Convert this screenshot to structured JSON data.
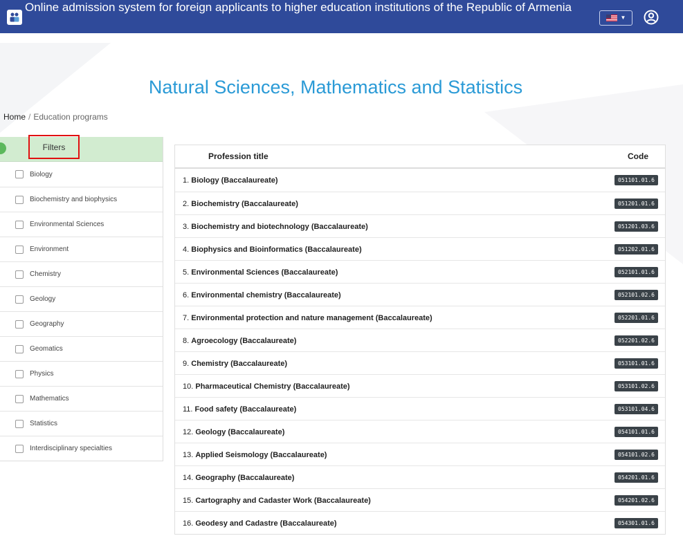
{
  "header": {
    "title": "Online admission system for foreign applicants to higher education institutions of the Republic of Armenia",
    "language_icon": "us-flag-icon",
    "user_icon": "user-circle-icon"
  },
  "page": {
    "title": "Natural Sciences, Mathematics and Statistics"
  },
  "breadcrumb": {
    "home": "Home",
    "separator": "/",
    "current": "Education programs"
  },
  "filters": {
    "title": "Filters",
    "items": [
      "Biology",
      "Biochemistry and biophysics",
      "Environmental Sciences",
      "Environment",
      "Chemistry",
      "Geology",
      "Geography",
      "Geomatics",
      "Physics",
      "Mathematics",
      "Statistics",
      "Interdisciplinary specialties"
    ]
  },
  "table": {
    "col_title": "Profession title",
    "col_code": "Code",
    "rows": [
      {
        "num": "1.",
        "title": "Biology (Baccalaureate)",
        "code": "051101.01.6"
      },
      {
        "num": "2.",
        "title": "Biochemistry (Baccalaureate)",
        "code": "051201.01.6"
      },
      {
        "num": "3.",
        "title": "Biochemistry and biotechnology (Baccalaureate)",
        "code": "051201.03.6"
      },
      {
        "num": "4.",
        "title": "Biophysics and Bioinformatics (Baccalaureate)",
        "code": "051202.01.6"
      },
      {
        "num": "5.",
        "title": "Environmental Sciences (Baccalaureate)",
        "code": "052101.01.6"
      },
      {
        "num": "6.",
        "title": "Environmental chemistry (Baccalaureate)",
        "code": "052101.02.6"
      },
      {
        "num": "7.",
        "title": "Environmental protection and nature management (Baccalaureate)",
        "code": "052201.01.6"
      },
      {
        "num": "8.",
        "title": "Agroecology (Baccalaureate)",
        "code": "052201.02.6"
      },
      {
        "num": "9.",
        "title": "Chemistry (Baccalaureate)",
        "code": "053101.01.6"
      },
      {
        "num": "10.",
        "title": "Pharmaceutical Chemistry (Baccalaureate)",
        "code": "053101.02.6"
      },
      {
        "num": "11.",
        "title": "Food safety (Baccalaureate)",
        "code": "053101.04.6"
      },
      {
        "num": "12.",
        "title": "Geology (Baccalaureate)",
        "code": "054101.01.6"
      },
      {
        "num": "13.",
        "title": "Applied Seismology (Baccalaureate)",
        "code": "054101.02.6"
      },
      {
        "num": "14.",
        "title": "Geography (Baccalaureate)",
        "code": "054201.01.6"
      },
      {
        "num": "15.",
        "title": "Cartography and Cadaster Work (Baccalaureate)",
        "code": "054201.02.6"
      },
      {
        "num": "16.",
        "title": "Geodesy and Cadastre (Baccalaureate)",
        "code": "054301.01.6"
      }
    ]
  },
  "colors": {
    "header_bg": "#2f4a9a",
    "title_color": "#2a9ad6",
    "filters_head_bg": "#d2ecd0",
    "highlight_border": "#e01010",
    "code_badge_bg": "#3a4248"
  }
}
